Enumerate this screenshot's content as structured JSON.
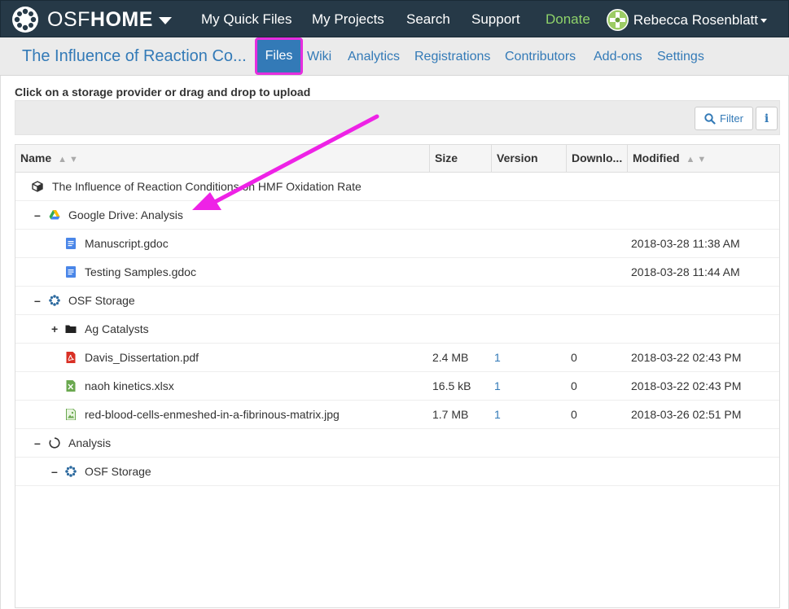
{
  "topbar": {
    "brand_light": "OSF",
    "brand_bold": "HOME",
    "nav": [
      "My Quick Files",
      "My Projects",
      "Search",
      "Support",
      "Donate"
    ],
    "user_name": "Rebecca Rosenblatt"
  },
  "project": {
    "title": "The Influence of Reaction Co...",
    "tabs": [
      "Files",
      "Wiki",
      "Analytics",
      "Registrations",
      "Contributors",
      "Add-ons",
      "Settings"
    ],
    "active_tab": "Files"
  },
  "files": {
    "instruction": "Click on a storage provider or drag and drop to upload",
    "filter_label": "Filter",
    "info_label": "i",
    "columns": [
      "Name",
      "Size",
      "Version",
      "Downlo...",
      "Modified"
    ],
    "rows": [
      {
        "toggle": "",
        "icon": "project-cube-icon",
        "name": "The Influence of Reaction Conditions on HMF Oxidation Rate",
        "size": "",
        "version": "",
        "downloads": "",
        "modified": ""
      },
      {
        "toggle": "–",
        "icon": "google-drive-icon",
        "name": "Google Drive: Analysis",
        "size": "",
        "version": "",
        "downloads": "",
        "modified": ""
      },
      {
        "toggle": "",
        "icon": "gdoc-icon",
        "name": "Manuscript.gdoc",
        "size": "",
        "version": "",
        "downloads": "",
        "modified": "2018-03-28 11:38 AM"
      },
      {
        "toggle": "",
        "icon": "gdoc-icon",
        "name": "Testing Samples.gdoc",
        "size": "",
        "version": "",
        "downloads": "",
        "modified": "2018-03-28 11:44 AM"
      },
      {
        "toggle": "–",
        "icon": "osf-storage-icon",
        "name": "OSF Storage",
        "size": "",
        "version": "",
        "downloads": "",
        "modified": ""
      },
      {
        "toggle": "+",
        "icon": "folder-icon",
        "name": "Ag Catalysts",
        "size": "",
        "version": "",
        "downloads": "",
        "modified": ""
      },
      {
        "toggle": "",
        "icon": "pdf-icon",
        "name": "Davis_Dissertation.pdf",
        "size": "2.4 MB",
        "version": "1",
        "downloads": "0",
        "modified": "2018-03-22 02:43 PM"
      },
      {
        "toggle": "",
        "icon": "excel-icon",
        "name": "naoh kinetics.xlsx",
        "size": "16.5 kB",
        "version": "1",
        "downloads": "0",
        "modified": "2018-03-22 02:43 PM"
      },
      {
        "toggle": "",
        "icon": "image-file-icon",
        "name": "red-blood-cells-enmeshed-in-a-fibrinous-matrix.jpg",
        "size": "1.7 MB",
        "version": "1",
        "downloads": "0",
        "modified": "2018-03-26 02:51 PM"
      },
      {
        "toggle": "–",
        "icon": "component-icon",
        "name": "Analysis",
        "size": "",
        "version": "",
        "downloads": "",
        "modified": ""
      },
      {
        "toggle": "–",
        "icon": "osf-storage-icon",
        "name": "OSF Storage",
        "size": "",
        "version": "",
        "downloads": "",
        "modified": ""
      }
    ]
  },
  "colors": {
    "navbar": "#263947",
    "link": "#337ab7",
    "donate": "#8fd36a",
    "highlight": "#e52ede"
  }
}
